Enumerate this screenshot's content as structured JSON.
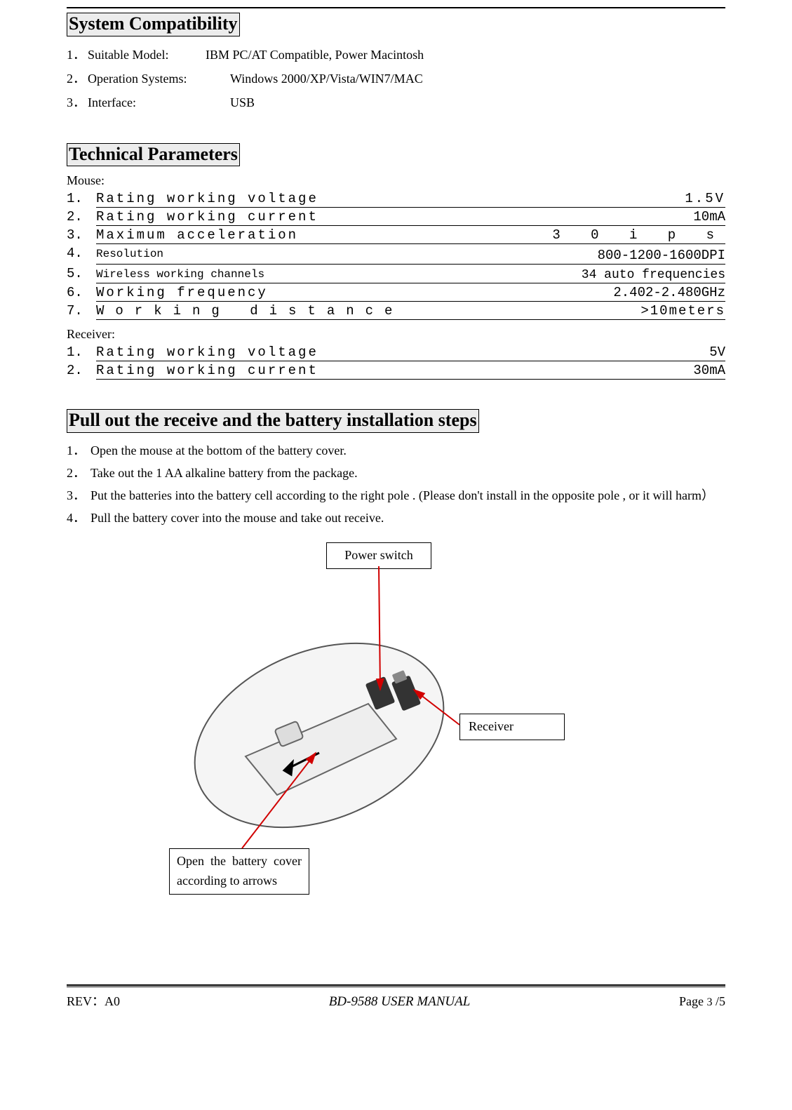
{
  "sections": {
    "compat_title": "System Compatibility",
    "tech_title": "Technical Parameters",
    "install_title": "Pull out the receive and the battery installation steps"
  },
  "compat": [
    {
      "num": "1．",
      "label": "Suitable Model:",
      "value": "IBM PC/AT Compatible, Power Macintosh"
    },
    {
      "num": "2．",
      "label": "Operation Systems:",
      "value": "Windows 2000/XP/Vista/WIN7/MAC"
    },
    {
      "num": "3．",
      "label": "Interface:",
      "value": "USB"
    }
  ],
  "tech": {
    "mouse_label": "Mouse:",
    "receiver_label": "Receiver:",
    "mouse": [
      {
        "num": "1.",
        "label": "Rating working voltage",
        "value": "1.5V",
        "cls": "wide"
      },
      {
        "num": "2.",
        "label": "Rating working current",
        "value": "10mA",
        "cls": "wide",
        "valcls": "nosp"
      },
      {
        "num": "3.",
        "label": "Maximum acceleration",
        "value": "3 0 i p s",
        "cls": "wide",
        "valcls": "wide2-val"
      },
      {
        "num": "4.",
        "label": "Resolution",
        "value": "800-1200-1600DPI",
        "cls": "sm"
      },
      {
        "num": "5.",
        "label": "Wireless working channels",
        "value": "34 auto frequencies",
        "cls": "sm",
        "valcls": "freq"
      },
      {
        "num": "6.",
        "label": "Working frequency",
        "value": "2.402-2.480GHz",
        "cls": "wide",
        "valcls": "nosp"
      },
      {
        "num": "7.",
        "label": "Working distance",
        "value": ">10meters",
        "cls": "wide2",
        "valcls": "nosp"
      }
    ],
    "receiver": [
      {
        "num": "1.",
        "label": "Rating working voltage",
        "value": "5V",
        "cls": "wide",
        "valcls": "nosp"
      },
      {
        "num": "2.",
        "label": "Rating working current",
        "value": "30mA",
        "cls": "wide",
        "valcls": "nosp"
      }
    ]
  },
  "install": [
    {
      "num": "1．",
      "text": "Open the mouse at the bottom of the battery cover."
    },
    {
      "num": "2．",
      "text": "Take out the 1 AA alkaline battery from the package."
    },
    {
      "num": "3．",
      "text": "Put the batteries into the battery cell according to the right pole . (Please don't install in the opposite pole , or it will harm）"
    },
    {
      "num": "4．",
      "text": "Pull the battery cover into the mouse and take out receive."
    }
  ],
  "diagram": {
    "power_switch": "Power switch",
    "receiver": "Receiver",
    "battery_cover": "Open the battery cover according to arrows"
  },
  "footer": {
    "rev": "REV：A0",
    "title": "BD-9588 USER MANUAL",
    "page_prefix": "Page ",
    "page_num": "3",
    "page_suffix": " /5"
  }
}
